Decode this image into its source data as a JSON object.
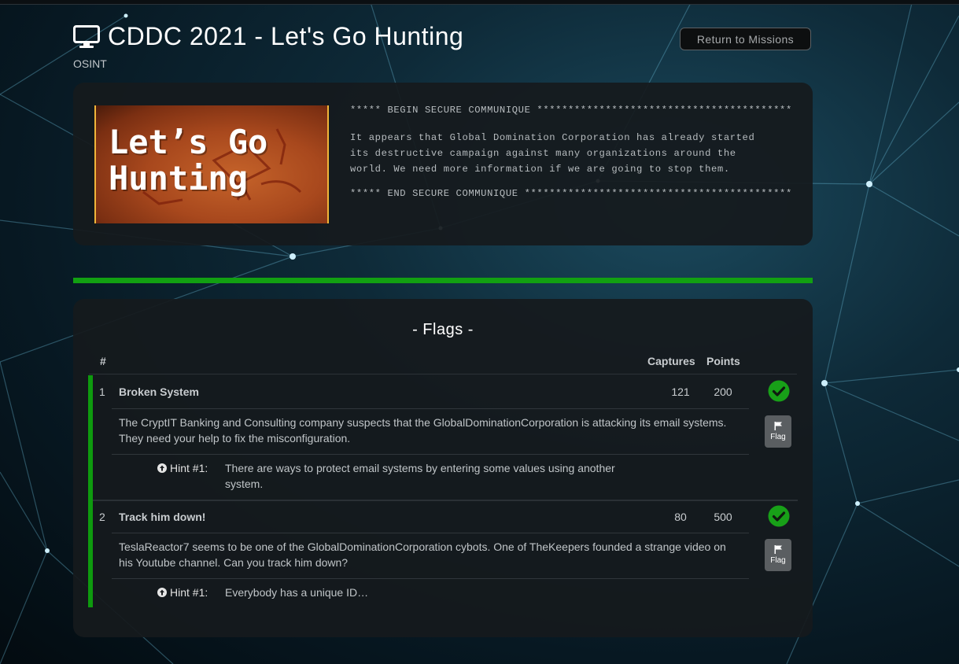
{
  "header": {
    "title": "CDDC 2021 - Let's Go Hunting",
    "category": "OSINT",
    "return_label": "Return to Missions"
  },
  "mission": {
    "image_text_line1": "Let’s Go",
    "image_text_line2": "Hunting",
    "begin_line": "***** BEGIN SECURE COMMUNIQUE *****************************************",
    "body": "It appears that Global Domination Corporation has already started its destructive campaign against many organizations around the world. We need more information if we are going to stop them.",
    "end_line": "***** END SECURE COMMUNIQUE *******************************************"
  },
  "flags": {
    "title": "- Flags -",
    "columns": {
      "num": "#",
      "captures": "Captures",
      "points": "Points"
    },
    "rows": [
      {
        "num": "1",
        "name": "Broken System",
        "captures": "121",
        "points": "200",
        "solved": true,
        "description": "The CryptIT Banking and Consulting company suspects that the GlobalDominationCorporation is attacking its email systems. They need your help to fix the misconfiguration.",
        "hint_label": "Hint #1:",
        "hint": "There are ways to protect email systems by entering some values using another system.",
        "flag_label": "Flag"
      },
      {
        "num": "2",
        "name": "Track him down!",
        "captures": "80",
        "points": "500",
        "solved": true,
        "description": "TeslaReactor7 seems to be one of the GlobalDominationCorporation cybots. One of TheKeepers founded a strange video on his Youtube channel. Can you track him down?",
        "hint_label": "Hint #1:",
        "hint": "Everybody has a unique ID…",
        "flag_label": "Flag"
      }
    ]
  },
  "colors": {
    "accent_green": "#12a012",
    "check_green": "#18a018",
    "panel": "#16191c"
  },
  "icons": {
    "title": "monitor-icon",
    "hint": "arrow-circle-up-icon",
    "solved": "check-circle-icon",
    "flag": "flag-icon"
  }
}
